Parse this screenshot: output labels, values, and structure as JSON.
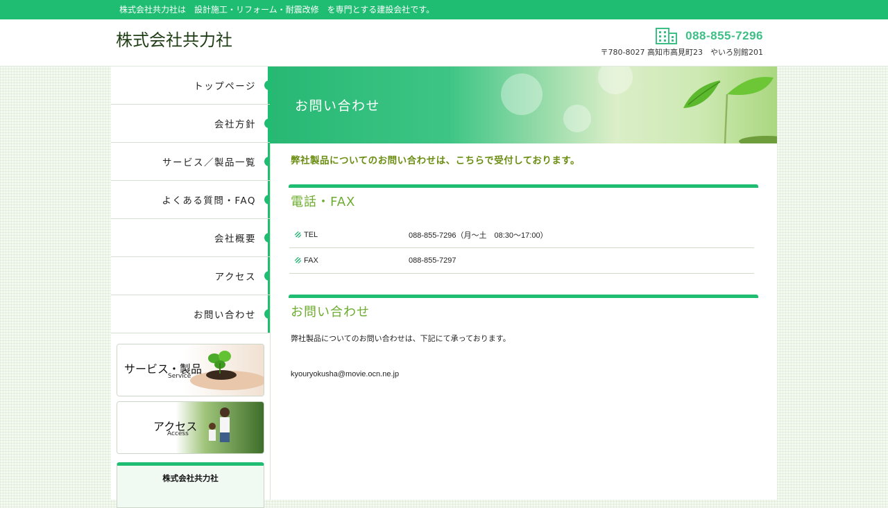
{
  "topbar": {
    "text": "株式会社共力社は　設計施工・リフォーム・耐震改修　を専門とする建設会社です。"
  },
  "header": {
    "logo": "株式会社共力社",
    "phone": "088-855-7296",
    "address": "〒780-8027 高知市高見町23　やいろ別館201",
    "phone_icon": "building-icon"
  },
  "sidebar": {
    "items": [
      {
        "label": "トップページ"
      },
      {
        "label": "会社方針"
      },
      {
        "label": "サービス／製品一覧"
      },
      {
        "label": "よくある質問・FAQ"
      },
      {
        "label": "会社概要"
      },
      {
        "label": "アクセス"
      },
      {
        "label": "お問い合わせ"
      }
    ],
    "banners": [
      {
        "title": "サービス・製品",
        "sub": "Service"
      },
      {
        "title": "アクセス",
        "sub": "Access"
      }
    ],
    "company_box": "株式会社共力社"
  },
  "main": {
    "hero_title": "お問い合わせ",
    "lead": "弊社製品についてのお問い合わせは、こちらで受付しております。",
    "section1_title": "電話・FAX",
    "rows": [
      {
        "label": "TEL",
        "value": "088-855-7296（月～土　08:30～17:00）"
      },
      {
        "label": "FAX",
        "value": "088-855-7297"
      }
    ],
    "section2_title": "お問い合わせ",
    "para": "弊社製品についてのお問い合わせは、下記にて承っております。",
    "email": "kyouryokusha@movie.ocn.ne.jp"
  },
  "colors": {
    "accent": "#1fbd72",
    "lead": "#6a8d12",
    "section_title": "#6cac2e"
  }
}
